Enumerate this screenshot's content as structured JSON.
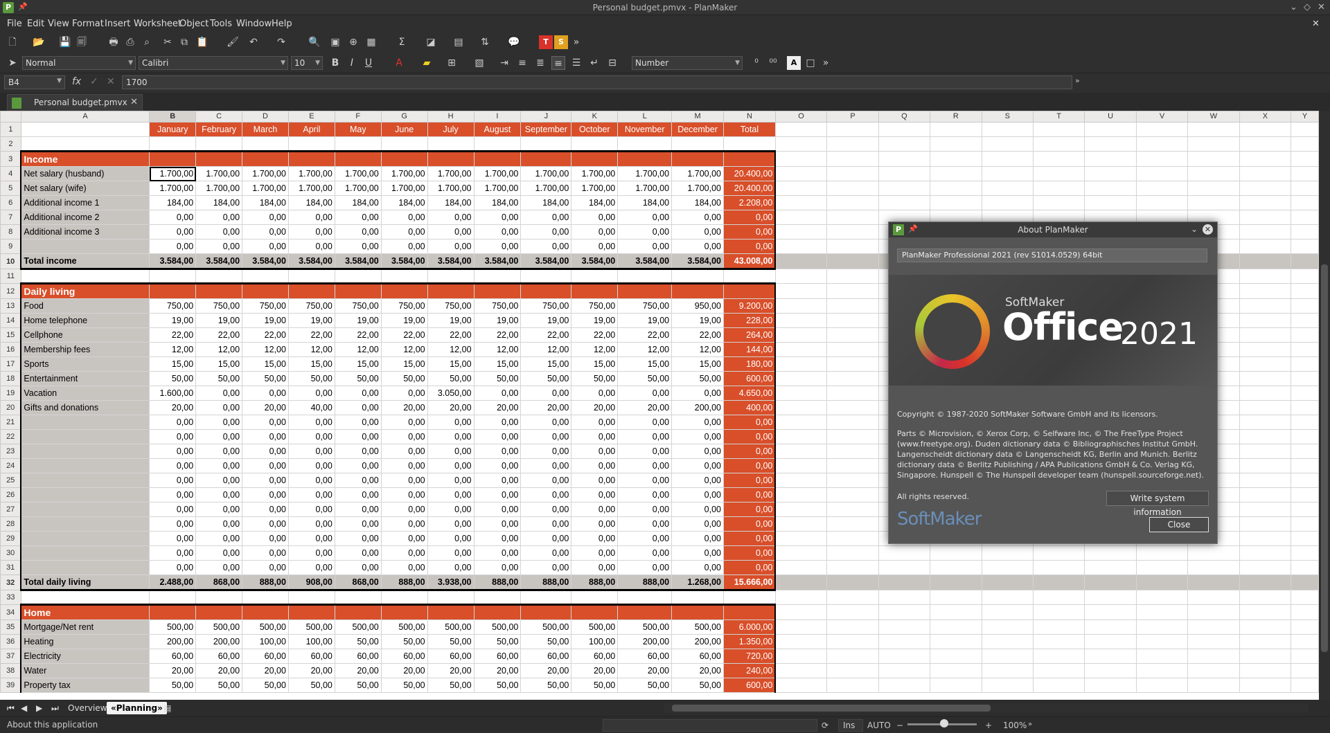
{
  "window": {
    "title": "Personal budget.pmvx - PlanMaker"
  },
  "menu": [
    "File",
    "Edit",
    "View",
    "Format",
    "Insert",
    "Worksheet",
    "Object",
    "Tools",
    "Window",
    "Help"
  ],
  "toolbar": {
    "style": "Normal",
    "font": "Calibri",
    "size": "10",
    "format": "Number",
    "bold": "B",
    "italic": "I",
    "underline": "U",
    "more": "»"
  },
  "formula": {
    "cellref": "B4",
    "fx": "fx",
    "value": "1700"
  },
  "document_tab": {
    "label": "Personal budget.pmvx"
  },
  "columns": [
    "A",
    "B",
    "C",
    "D",
    "E",
    "F",
    "G",
    "H",
    "I",
    "J",
    "K",
    "L",
    "M",
    "N",
    "O",
    "P",
    "Q",
    "R",
    "S",
    "T",
    "U",
    "V",
    "W",
    "X",
    "Y"
  ],
  "header_row": [
    "January",
    "February",
    "March",
    "April",
    "May",
    "June",
    "July",
    "August",
    "September",
    "October",
    "November",
    "December",
    "Total"
  ],
  "rows": [
    {
      "n": "1",
      "type": "header"
    },
    {
      "n": "2",
      "type": "blank"
    },
    {
      "n": "3",
      "type": "section",
      "label": "Income"
    },
    {
      "n": "4",
      "type": "data",
      "label": "Net salary (husband)",
      "values": [
        "1.700,00",
        "1.700,00",
        "1.700,00",
        "1.700,00",
        "1.700,00",
        "1.700,00",
        "1.700,00",
        "1.700,00",
        "1.700,00",
        "1.700,00",
        "1.700,00",
        "1.700,00"
      ],
      "total": "20.400,00"
    },
    {
      "n": "5",
      "type": "data",
      "label": "Net salary (wife)",
      "values": [
        "1.700,00",
        "1.700,00",
        "1.700,00",
        "1.700,00",
        "1.700,00",
        "1.700,00",
        "1.700,00",
        "1.700,00",
        "1.700,00",
        "1.700,00",
        "1.700,00",
        "1.700,00"
      ],
      "total": "20.400,00"
    },
    {
      "n": "6",
      "type": "data",
      "label": "Additional income  1",
      "values": [
        "184,00",
        "184,00",
        "184,00",
        "184,00",
        "184,00",
        "184,00",
        "184,00",
        "184,00",
        "184,00",
        "184,00",
        "184,00",
        "184,00"
      ],
      "total": "2.208,00"
    },
    {
      "n": "7",
      "type": "data",
      "label": "Additional income  2",
      "values": [
        "0,00",
        "0,00",
        "0,00",
        "0,00",
        "0,00",
        "0,00",
        "0,00",
        "0,00",
        "0,00",
        "0,00",
        "0,00",
        "0,00"
      ],
      "total": "0,00"
    },
    {
      "n": "8",
      "type": "data",
      "label": "Additional income  3",
      "values": [
        "0,00",
        "0,00",
        "0,00",
        "0,00",
        "0,00",
        "0,00",
        "0,00",
        "0,00",
        "0,00",
        "0,00",
        "0,00",
        "0,00"
      ],
      "total": "0,00"
    },
    {
      "n": "9",
      "type": "data",
      "label": "",
      "values": [
        "0,00",
        "0,00",
        "0,00",
        "0,00",
        "0,00",
        "0,00",
        "0,00",
        "0,00",
        "0,00",
        "0,00",
        "0,00",
        "0,00"
      ],
      "total": "0,00"
    },
    {
      "n": "10",
      "type": "total",
      "label": "Total income",
      "values": [
        "3.584,00",
        "3.584,00",
        "3.584,00",
        "3.584,00",
        "3.584,00",
        "3.584,00",
        "3.584,00",
        "3.584,00",
        "3.584,00",
        "3.584,00",
        "3.584,00",
        "3.584,00"
      ],
      "total": "43.008,00"
    },
    {
      "n": "11",
      "type": "blank"
    },
    {
      "n": "12",
      "type": "section",
      "label": "Daily living"
    },
    {
      "n": "13",
      "type": "data",
      "label": "Food",
      "values": [
        "750,00",
        "750,00",
        "750,00",
        "750,00",
        "750,00",
        "750,00",
        "750,00",
        "750,00",
        "750,00",
        "750,00",
        "750,00",
        "950,00"
      ],
      "total": "9.200,00"
    },
    {
      "n": "14",
      "type": "data",
      "label": "Home telephone",
      "values": [
        "19,00",
        "19,00",
        "19,00",
        "19,00",
        "19,00",
        "19,00",
        "19,00",
        "19,00",
        "19,00",
        "19,00",
        "19,00",
        "19,00"
      ],
      "total": "228,00"
    },
    {
      "n": "15",
      "type": "data",
      "label": "Cellphone",
      "values": [
        "22,00",
        "22,00",
        "22,00",
        "22,00",
        "22,00",
        "22,00",
        "22,00",
        "22,00",
        "22,00",
        "22,00",
        "22,00",
        "22,00"
      ],
      "total": "264,00"
    },
    {
      "n": "16",
      "type": "data",
      "label": "Membership fees",
      "values": [
        "12,00",
        "12,00",
        "12,00",
        "12,00",
        "12,00",
        "12,00",
        "12,00",
        "12,00",
        "12,00",
        "12,00",
        "12,00",
        "12,00"
      ],
      "total": "144,00"
    },
    {
      "n": "17",
      "type": "data",
      "label": "Sports",
      "values": [
        "15,00",
        "15,00",
        "15,00",
        "15,00",
        "15,00",
        "15,00",
        "15,00",
        "15,00",
        "15,00",
        "15,00",
        "15,00",
        "15,00"
      ],
      "total": "180,00"
    },
    {
      "n": "18",
      "type": "data",
      "label": "Entertainment",
      "values": [
        "50,00",
        "50,00",
        "50,00",
        "50,00",
        "50,00",
        "50,00",
        "50,00",
        "50,00",
        "50,00",
        "50,00",
        "50,00",
        "50,00"
      ],
      "total": "600,00"
    },
    {
      "n": "19",
      "type": "data",
      "label": "Vacation",
      "values": [
        "1.600,00",
        "0,00",
        "0,00",
        "0,00",
        "0,00",
        "0,00",
        "3.050,00",
        "0,00",
        "0,00",
        "0,00",
        "0,00",
        "0,00"
      ],
      "total": "4.650,00"
    },
    {
      "n": "20",
      "type": "data",
      "label": "Gifts and donations",
      "values": [
        "20,00",
        "0,00",
        "20,00",
        "40,00",
        "0,00",
        "20,00",
        "20,00",
        "20,00",
        "20,00",
        "20,00",
        "20,00",
        "200,00"
      ],
      "total": "400,00"
    },
    {
      "n": "21",
      "type": "data",
      "label": "",
      "values": [
        "0,00",
        "0,00",
        "0,00",
        "0,00",
        "0,00",
        "0,00",
        "0,00",
        "0,00",
        "0,00",
        "0,00",
        "0,00",
        "0,00"
      ],
      "total": "0,00"
    },
    {
      "n": "22",
      "type": "data",
      "label": "",
      "values": [
        "0,00",
        "0,00",
        "0,00",
        "0,00",
        "0,00",
        "0,00",
        "0,00",
        "0,00",
        "0,00",
        "0,00",
        "0,00",
        "0,00"
      ],
      "total": "0,00"
    },
    {
      "n": "23",
      "type": "data",
      "label": "",
      "values": [
        "0,00",
        "0,00",
        "0,00",
        "0,00",
        "0,00",
        "0,00",
        "0,00",
        "0,00",
        "0,00",
        "0,00",
        "0,00",
        "0,00"
      ],
      "total": "0,00"
    },
    {
      "n": "24",
      "type": "data",
      "label": "",
      "values": [
        "0,00",
        "0,00",
        "0,00",
        "0,00",
        "0,00",
        "0,00",
        "0,00",
        "0,00",
        "0,00",
        "0,00",
        "0,00",
        "0,00"
      ],
      "total": "0,00"
    },
    {
      "n": "25",
      "type": "data",
      "label": "",
      "values": [
        "0,00",
        "0,00",
        "0,00",
        "0,00",
        "0,00",
        "0,00",
        "0,00",
        "0,00",
        "0,00",
        "0,00",
        "0,00",
        "0,00"
      ],
      "total": "0,00"
    },
    {
      "n": "26",
      "type": "data",
      "label": "",
      "values": [
        "0,00",
        "0,00",
        "0,00",
        "0,00",
        "0,00",
        "0,00",
        "0,00",
        "0,00",
        "0,00",
        "0,00",
        "0,00",
        "0,00"
      ],
      "total": "0,00"
    },
    {
      "n": "27",
      "type": "data",
      "label": "",
      "values": [
        "0,00",
        "0,00",
        "0,00",
        "0,00",
        "0,00",
        "0,00",
        "0,00",
        "0,00",
        "0,00",
        "0,00",
        "0,00",
        "0,00"
      ],
      "total": "0,00"
    },
    {
      "n": "28",
      "type": "data",
      "label": "",
      "values": [
        "0,00",
        "0,00",
        "0,00",
        "0,00",
        "0,00",
        "0,00",
        "0,00",
        "0,00",
        "0,00",
        "0,00",
        "0,00",
        "0,00"
      ],
      "total": "0,00"
    },
    {
      "n": "29",
      "type": "data",
      "label": "",
      "values": [
        "0,00",
        "0,00",
        "0,00",
        "0,00",
        "0,00",
        "0,00",
        "0,00",
        "0,00",
        "0,00",
        "0,00",
        "0,00",
        "0,00"
      ],
      "total": "0,00"
    },
    {
      "n": "30",
      "type": "data",
      "label": "",
      "values": [
        "0,00",
        "0,00",
        "0,00",
        "0,00",
        "0,00",
        "0,00",
        "0,00",
        "0,00",
        "0,00",
        "0,00",
        "0,00",
        "0,00"
      ],
      "total": "0,00"
    },
    {
      "n": "31",
      "type": "data",
      "label": "",
      "values": [
        "0,00",
        "0,00",
        "0,00",
        "0,00",
        "0,00",
        "0,00",
        "0,00",
        "0,00",
        "0,00",
        "0,00",
        "0,00",
        "0,00"
      ],
      "total": "0,00"
    },
    {
      "n": "32",
      "type": "total",
      "label": "Total daily living",
      "values": [
        "2.488,00",
        "868,00",
        "888,00",
        "908,00",
        "868,00",
        "888,00",
        "3.938,00",
        "888,00",
        "888,00",
        "888,00",
        "888,00",
        "1.268,00"
      ],
      "total": "15.666,00"
    },
    {
      "n": "33",
      "type": "blank"
    },
    {
      "n": "34",
      "type": "section",
      "label": "Home"
    },
    {
      "n": "35",
      "type": "data",
      "label": "Mortgage/Net rent",
      "values": [
        "500,00",
        "500,00",
        "500,00",
        "500,00",
        "500,00",
        "500,00",
        "500,00",
        "500,00",
        "500,00",
        "500,00",
        "500,00",
        "500,00"
      ],
      "total": "6.000,00"
    },
    {
      "n": "36",
      "type": "data",
      "label": "Heating",
      "values": [
        "200,00",
        "200,00",
        "100,00",
        "100,00",
        "50,00",
        "50,00",
        "50,00",
        "50,00",
        "50,00",
        "100,00",
        "200,00",
        "200,00"
      ],
      "total": "1.350,00"
    },
    {
      "n": "37",
      "type": "data",
      "label": "Electricity",
      "values": [
        "60,00",
        "60,00",
        "60,00",
        "60,00",
        "60,00",
        "60,00",
        "60,00",
        "60,00",
        "60,00",
        "60,00",
        "60,00",
        "60,00"
      ],
      "total": "720,00"
    },
    {
      "n": "38",
      "type": "data",
      "label": "Water",
      "values": [
        "20,00",
        "20,00",
        "20,00",
        "20,00",
        "20,00",
        "20,00",
        "20,00",
        "20,00",
        "20,00",
        "20,00",
        "20,00",
        "20,00"
      ],
      "total": "240,00"
    },
    {
      "n": "39",
      "type": "data",
      "label": "Property tax",
      "values": [
        "50,00",
        "50,00",
        "50,00",
        "50,00",
        "50,00",
        "50,00",
        "50,00",
        "50,00",
        "50,00",
        "50,00",
        "50,00",
        "50,00"
      ],
      "total": "600,00"
    }
  ],
  "sheet_tabs": {
    "overview": "Overview",
    "planning": "«Planning»"
  },
  "status": {
    "text": "About this application",
    "ins": "Ins",
    "auto": "AUTO",
    "zoom": "100%",
    "zoom_minus": "−",
    "zoom_plus": "+"
  },
  "dialog": {
    "title": "About PlanMaker",
    "version": "PlanMaker Professional 2021 (rev S1014.0529) 64bit",
    "brand_small": "SoftMaker",
    "brand_office": "Office",
    "brand_year": "2021",
    "copyright": "Copyright © 1987-2020 SoftMaker Software GmbH and its licensors.",
    "parts_1": "Parts © Microvision, © Xerox Corp, © Selfware Inc, © The FreeType Project",
    "parts_2": "(www.freetype.org). Duden dictionary data © Bibliographisches Institut GmbH.",
    "parts_3": "Langenscheidt dictionary data © Langenscheidt KG, Berlin and Munich. Berlitz",
    "parts_4": "dictionary data © Berlitz Publishing / APA Publications GmbH & Co. Verlag KG,",
    "parts_5": "Singapore. Hunspell © The Hunspell developer team (hunspell.sourceforge.net).",
    "rights": "All rights reserved.",
    "sysinfo_button": "Write system information",
    "close_button": "Close",
    "logo_text": "SoftMaker"
  },
  "colors": {
    "accent": "#d84f2a",
    "label_bg": "#c8c5c1",
    "dark_ui": "#2f2f2f"
  }
}
